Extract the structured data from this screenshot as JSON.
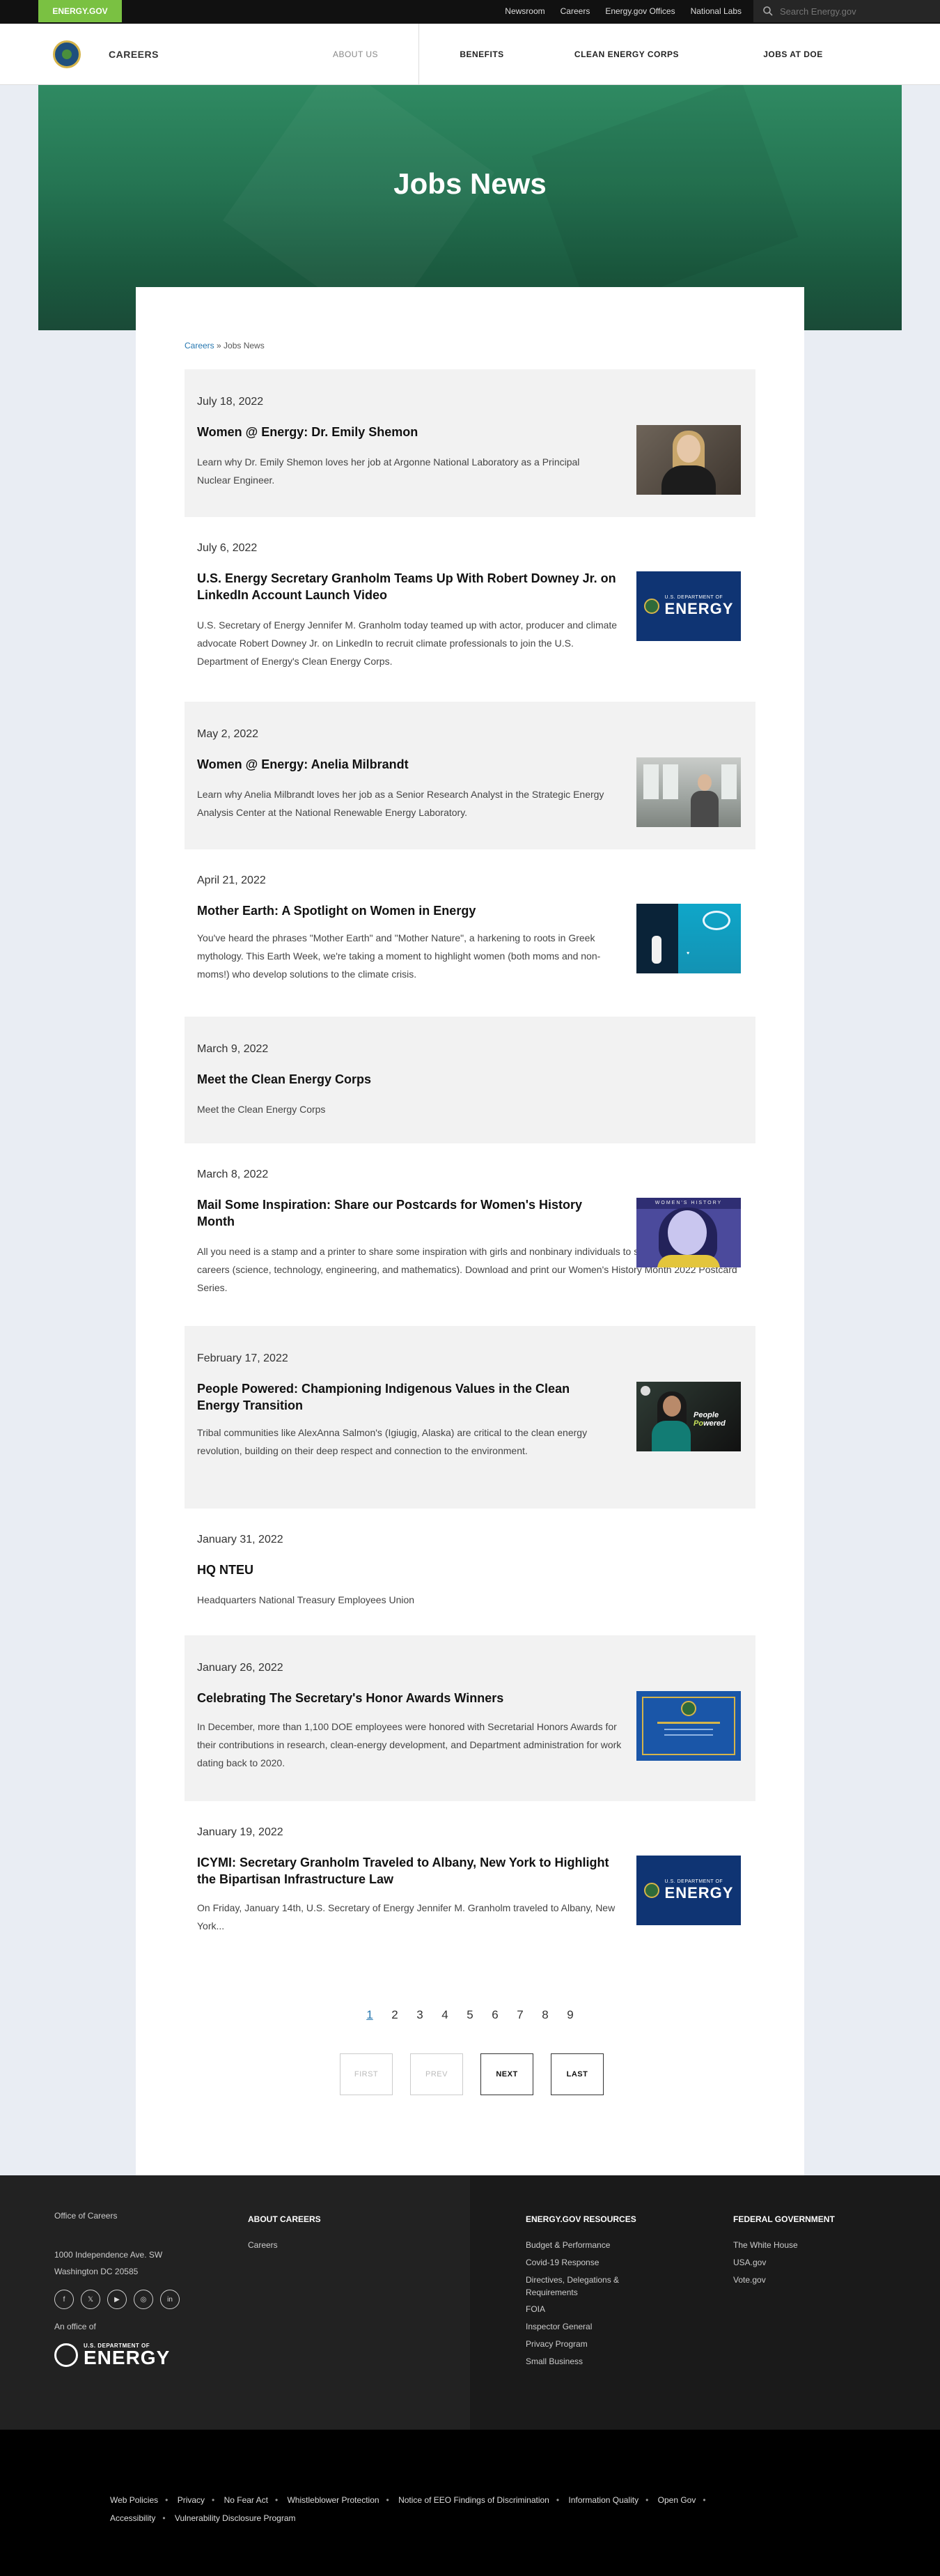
{
  "topbar": {
    "brand": "ENERGY.GOV",
    "links": [
      "Newsroom",
      "Careers",
      "Energy.gov Offices",
      "National Labs"
    ],
    "search_placeholder": "Search Energy.gov"
  },
  "nav": {
    "title": "CAREERS",
    "items": [
      "ABOUT US",
      "BENEFITS",
      "CLEAN ENERGY CORPS",
      "JOBS AT DOE"
    ]
  },
  "hero": {
    "title": "Jobs News"
  },
  "breadcrumb": {
    "home": "Careers",
    "sep": " » ",
    "current": "Jobs News"
  },
  "articles": [
    {
      "date": "July 18, 2022",
      "title": "Women @ Energy: Dr. Emily Shemon",
      "desc": "Learn why Dr. Emily Shemon loves her job at Argonne National Laboratory as a Principal Nuclear Engineer."
    },
    {
      "date": "July 6, 2022",
      "title": "U.S. Energy Secretary Granholm Teams Up With Robert Downey Jr. on LinkedIn Account Launch Video",
      "desc": "U.S. Secretary of Energy Jennifer M. Granholm today teamed up with actor, producer and climate advocate Robert Downey Jr. on LinkedIn to recruit climate professionals to join the U.S. Department of Energy's Clean Energy Corps.",
      "thumb_a": "U.S. DEPARTMENT OF",
      "thumb_b": "ENERGY"
    },
    {
      "date": "May 2, 2022",
      "title": "Women @ Energy: Anelia Milbrandt",
      "desc": "Learn why Anelia Milbrandt loves her job as a Senior Research Analyst in the Strategic Energy Analysis Center at the National Renewable Energy Laboratory."
    },
    {
      "date": "April 21, 2022",
      "title": "Mother Earth: A Spotlight on Women in Energy",
      "desc": "You've heard the phrases \"Mother Earth\" and \"Mother Nature\", a harkening to roots in Greek mythology. This Earth Week, we're taking a moment to highlight women (both moms and non-moms!) who develop solutions to the climate crisis."
    },
    {
      "date": "March 9, 2022",
      "title": "Meet the Clean Energy Corps",
      "desc": "Meet the Clean Energy Corps"
    },
    {
      "date": "March 8, 2022",
      "title": "Mail Some Inspiration: Share our Postcards for Women's History Month",
      "desc": "All you need is a stamp and a printer to share some inspiration with girls and nonbinary individuals to see themselves in STEM careers (science, technology, engineering, and mathematics). Download and print our Women's History Month 2022 Postcard Series."
    },
    {
      "date": "February 17, 2022",
      "title": "People Powered: Championing Indigenous Values in the Clean Energy Transition",
      "desc": "Tribal communities like AlexAnna Salmon's (Igiugig, Alaska) are critical to the clean energy revolution, building on their deep respect and connection to the environment."
    },
    {
      "date": "January 31, 2022",
      "title": "HQ NTEU",
      "desc": "Headquarters National Treasury Employees Union"
    },
    {
      "date": "January 26, 2022",
      "title": "Celebrating The Secretary's Honor Awards Winners",
      "desc": "In December, more than 1,100 DOE employees were honored with Secretarial Honors Awards for their contributions in research, clean-energy development, and Department administration for work dating back to 2020."
    },
    {
      "date": "January 19, 2022",
      "title": "ICYMI: Secretary Granholm Traveled to Albany, New York to Highlight the Bipartisan Infrastructure Law",
      "desc": "On Friday, January 14th, U.S. Secretary of Energy Jennifer M. Granholm traveled to Albany, New York...",
      "thumb_a": "U.S. DEPARTMENT OF",
      "thumb_b": "ENERGY"
    }
  ],
  "pagination": {
    "pages": [
      "1",
      "2",
      "3",
      "4",
      "5",
      "6",
      "7",
      "8",
      "9"
    ],
    "first": "FIRST",
    "prev": "PREV",
    "next": "NEXT",
    "last": "LAST"
  },
  "footer": {
    "office_of": "Office of Careers",
    "address": "1000 Independence Ave. SW Washington DC 20585",
    "an_office_of": "An office of",
    "logo_a": "U.S. DEPARTMENT OF",
    "logo_b": "ENERGY",
    "about_heading": "ABOUT CAREERS",
    "about_items": [
      "Careers"
    ],
    "resources_heading": "ENERGY.GOV RESOURCES",
    "resources_items": [
      "Budget & Performance",
      "Covid-19 Response",
      "Directives, Delegations & Requirements",
      "FOIA",
      "Inspector General",
      "Privacy Program",
      "Small Business"
    ],
    "federal_heading": "FEDERAL GOVERNMENT",
    "federal_items": [
      "The White House",
      "USA.gov",
      "Vote.gov"
    ]
  },
  "bottom_links": [
    "Web Policies",
    "Privacy",
    "No Fear Act",
    "Whistleblower Protection",
    "Notice of EEO Findings of Discrimination",
    "Information Quality",
    "Open Gov",
    "Accessibility",
    "Vulnerability Disclosure Program"
  ]
}
